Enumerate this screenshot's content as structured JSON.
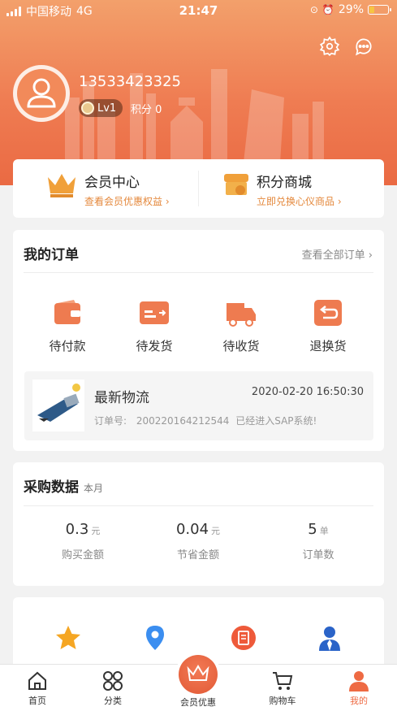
{
  "status_bar": {
    "carrier": "中国移动",
    "network": "4G",
    "time": "21:47",
    "battery": "29%",
    "battery_level": 0.29
  },
  "profile": {
    "phone": "13533423325",
    "level": "Lv1",
    "points_label": "积分",
    "points_value": "0"
  },
  "member_card": {
    "member_center": {
      "title": "会员中心",
      "subtitle": "查看会员优惠权益 ›"
    },
    "points_mall": {
      "title": "积分商城",
      "subtitle": "立即兑换心仪商品 ›"
    }
  },
  "orders": {
    "title": "我的订单",
    "view_all": "查看全部订单 ›",
    "categories": [
      {
        "label": "待付款",
        "icon": "wallet-icon"
      },
      {
        "label": "待发货",
        "icon": "shipping-card-icon"
      },
      {
        "label": "待收货",
        "icon": "truck-icon"
      },
      {
        "label": "退换货",
        "icon": "return-icon"
      }
    ],
    "logistics": {
      "title": "最新物流",
      "time": "2020-02-20 16:50:30",
      "order_label": "订单号:",
      "order_no": "200220164212544",
      "status": "已经进入SAP系统!"
    }
  },
  "purchase": {
    "title": "采购数据",
    "period": "本月",
    "stats": [
      {
        "value": "0.3",
        "unit": "元",
        "label": "购买金额"
      },
      {
        "value": "0.04",
        "unit": "元",
        "label": "节省金额"
      },
      {
        "value": "5",
        "unit": "单",
        "label": "订单数"
      }
    ]
  },
  "tabbar": {
    "items": [
      {
        "label": "首页",
        "icon": "home-icon"
      },
      {
        "label": "分类",
        "icon": "category-icon"
      },
      {
        "label": "会员优惠",
        "icon": "crown-icon"
      },
      {
        "label": "购物车",
        "icon": "cart-icon"
      },
      {
        "label": "我的",
        "icon": "person-icon"
      }
    ]
  },
  "colors": {
    "accent": "#ee6a43",
    "gold": "#e4883c"
  }
}
